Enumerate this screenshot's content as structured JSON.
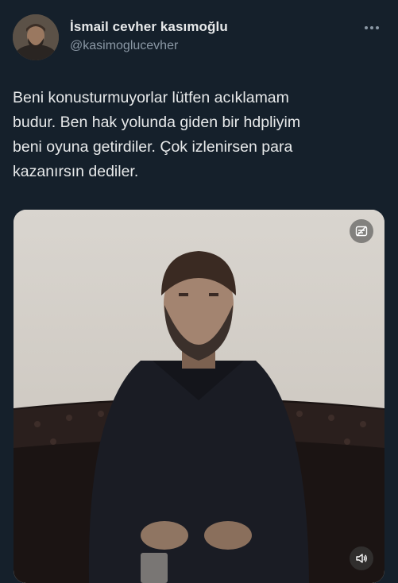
{
  "author": {
    "display_name": "İsmail cevher kasımoğlu",
    "handle": "@kasimoglucevher",
    "avatar_icon": "avatar-photo"
  },
  "tweet": {
    "lines": [
      "Beni konusturmuyorlar lütfen acıklamam",
      "budur. Ben hak yolunda giden bir hdpliyim",
      "beni oyuna getirdiler. Çok izlenirsen para",
      "kazanırsın dediler."
    ]
  },
  "media": {
    "type": "video",
    "top_right_icon": "subtitles-icon",
    "bottom_right_icon": "volume-icon"
  },
  "colors": {
    "background": "#15202b",
    "text": "#e7e9ea",
    "secondary": "#8b98a5"
  }
}
